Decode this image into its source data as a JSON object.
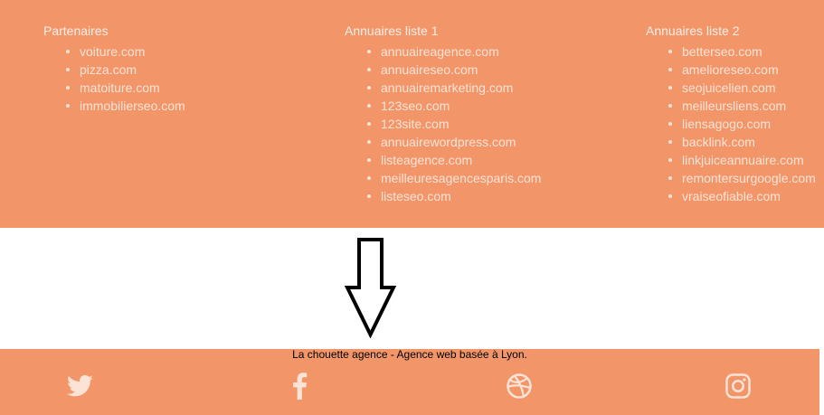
{
  "columns": [
    {
      "title": "Partenaires",
      "items": [
        "voiture.com",
        "pizza.com",
        "matoiture.com",
        "immobilierseo.com"
      ]
    },
    {
      "title": "Annuaires liste 1",
      "items": [
        "annuaireagence.com",
        "annuaireseo.com",
        "annuairemarketing.com",
        "123seo.com",
        "123site.com",
        "annuairewordpress.com",
        "listeagence.com",
        "meilleuresagencesparis.com",
        "listeseo.com"
      ]
    },
    {
      "title": "Annuaires liste 2",
      "items": [
        "betterseo.com",
        "amelioreseo.com",
        "seojuicelien.com",
        "meilleursliens.com",
        "liensagogo.com",
        "backlink.com",
        "linkjuiceannuaire.com",
        "remontersurgoogle.com",
        "vraiseofiable.com"
      ]
    }
  ],
  "footer": {
    "tagline": "La chouette agence - Agence web basée à Lyon."
  },
  "social": [
    "twitter-icon",
    "facebook-icon",
    "dribbble-icon",
    "instagram-icon"
  ],
  "colors": {
    "background": "#f2966a",
    "link_text": "#fbe3d6",
    "heading_text": "#fdeee6"
  }
}
